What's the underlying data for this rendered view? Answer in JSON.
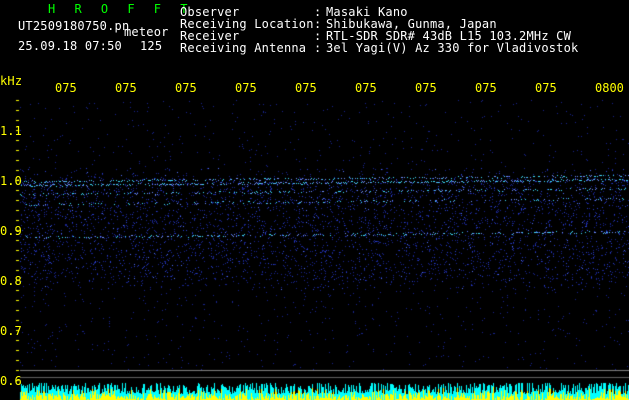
{
  "header": {
    "title": "H R O F F T",
    "filename": "UT2509180750.pn",
    "meteor_label": "meteor",
    "datetime": "25.09.18 07:50",
    "count": "125",
    "observer_label": "Observer",
    "observer_sep": ":",
    "observer_value": "Masaki Kano",
    "location_label": "Receiving Location",
    "location_sep": ":",
    "location_value": "Shibukawa, Gunma, Japan",
    "receiver_label": "Receiver",
    "receiver_sep": ":",
    "receiver_value": "RTL-SDR SDR# 43dB L15 103.2MHz CW",
    "antenna_label": "Receiving Antenna",
    "antenna_sep": ":",
    "antenna_value": "3el Yagi(V) Az 330 for Vladivostok"
  },
  "axes": {
    "y_unit": "kHz",
    "y_ticks": [
      "1.1",
      "1.0",
      "0.9",
      "0.8",
      "0.7",
      "0.6"
    ],
    "x_ticks": [
      "075",
      "075",
      "075",
      "075",
      "075",
      "075",
      "075",
      "075",
      "075",
      "0800"
    ]
  },
  "colors": {
    "background": "#000000",
    "title": "#00ff00",
    "header_text": "#00ffff",
    "axis_text": "#ffff00",
    "signal": "#2030c0",
    "bright_line": "#40e0ff",
    "level_bar": "#ffff00"
  }
}
